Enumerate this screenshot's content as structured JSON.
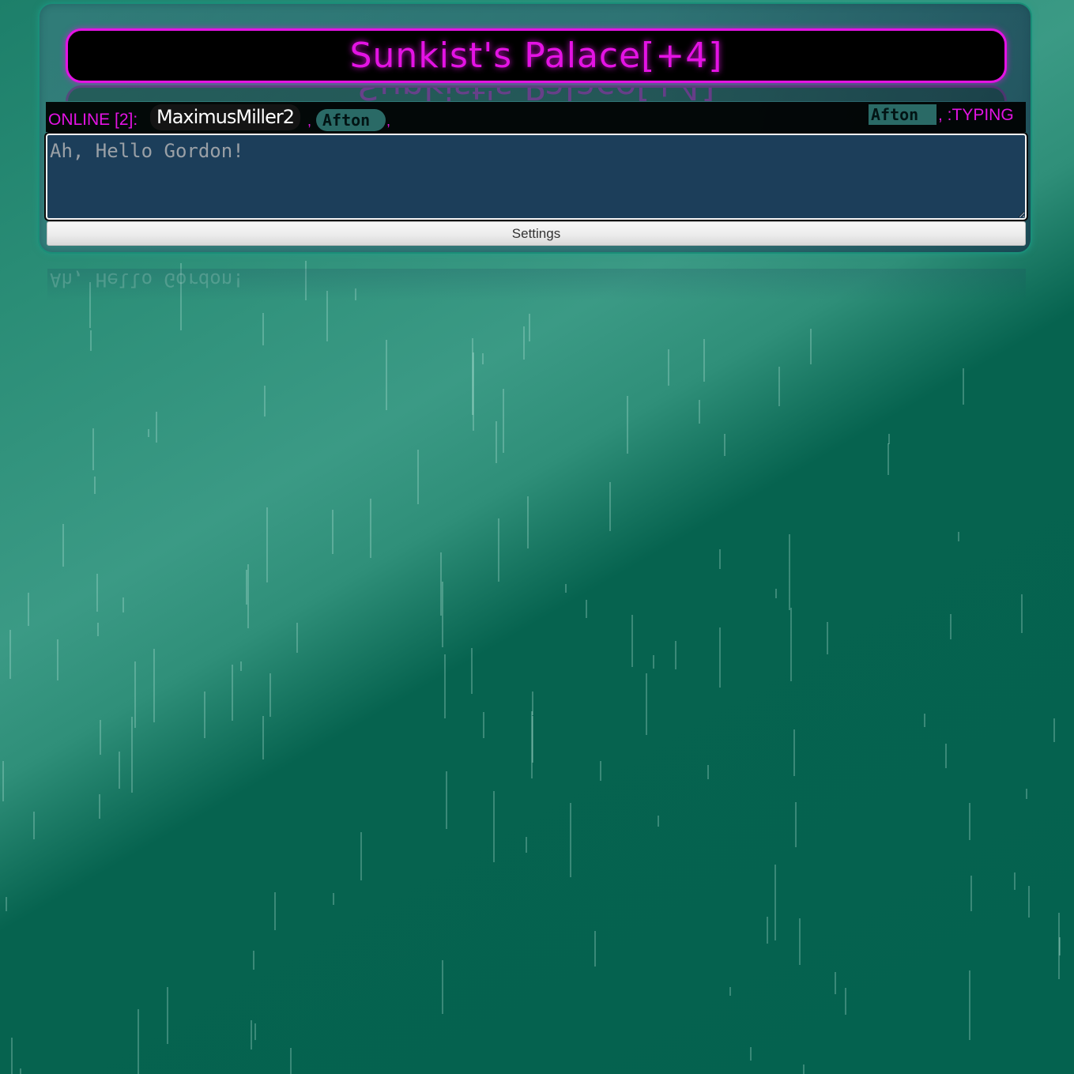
{
  "room": {
    "title": "Sunkist's Palace[+4]"
  },
  "status": {
    "online_label": "ONLINE [2]:",
    "users": [
      "MaximusMiller2",
      "Afton"
    ],
    "separator": ",",
    "typing_user": "Afton",
    "typing_label": ", :TYPING"
  },
  "composer": {
    "placeholder": "Ah, Hello Gordon!"
  },
  "settings": {
    "label": "Settings"
  },
  "colors": {
    "accent": "#e413e4",
    "panel_border": "#1a8e78",
    "background": "#04624f",
    "input_bg": "#1c3e5a"
  }
}
